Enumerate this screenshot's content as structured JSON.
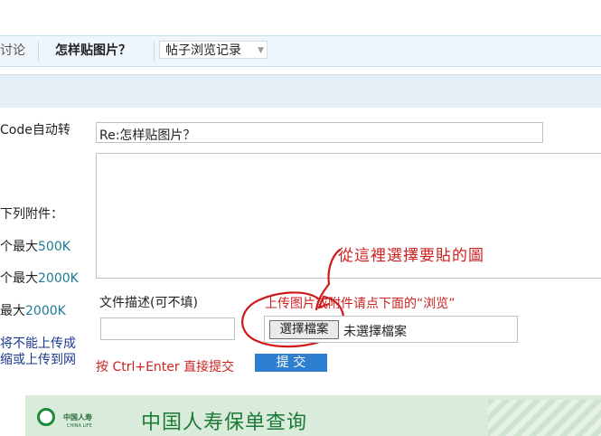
{
  "tabs": {
    "discuss": "讨论",
    "post_title": "怎样贴图片？",
    "history": "帖子浏览记录"
  },
  "left_labels": {
    "code_auto": "Code自动转",
    "attachments": "下列附件：",
    "limit1_prefix": "个最大",
    "limit1_value": "500K",
    "limit2_prefix": "个最大",
    "limit2_value": "2000K",
    "limit3_prefix": "最大",
    "limit3_value": "2000K",
    "note1": "将不能上传成",
    "note2": "缩或上传到网"
  },
  "form": {
    "subject_value": "Re:怎样贴图片？",
    "description_label": "文件描述(可不填)",
    "upload_hint": "上传图片或附件请点下面的“浏览”",
    "choose_file_button": "選擇檔案",
    "no_file_text": "未選擇檔案",
    "hotkey_hint": "按 Ctrl+Enter 直接提交",
    "submit_button": "提 交"
  },
  "annotation": "從這裡選擇要貼的圖",
  "banner": {
    "brand_cn": "中国人寿",
    "brand_en": "CHINA LIFE",
    "title": "中国人寿保单查询"
  },
  "colors": {
    "tab_bar_bg": "#eef6fb",
    "band_bg": "#e4eef7",
    "accent_red": "#cc2222",
    "submit_blue": "#2f7fd0",
    "limit_teal": "#1b7c94",
    "banner_green": "#1d7a38"
  }
}
